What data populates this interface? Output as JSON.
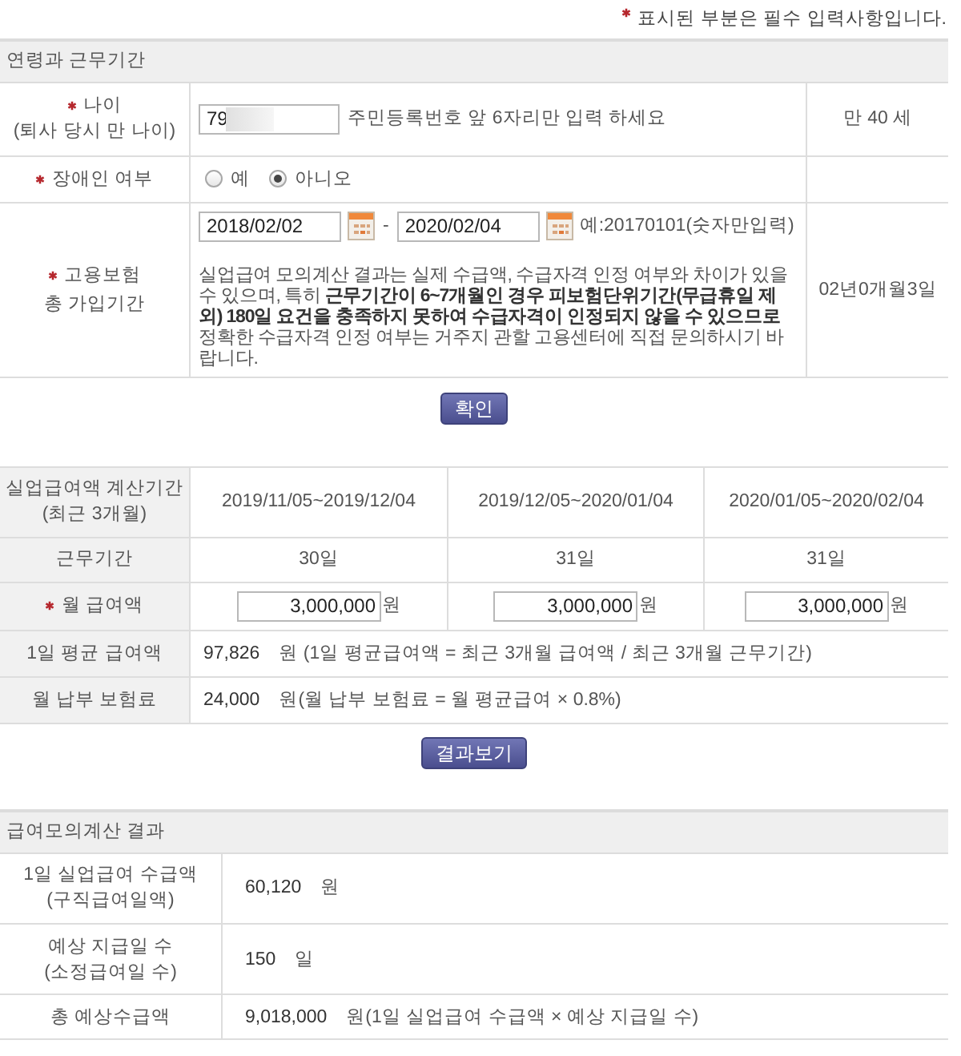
{
  "notice": {
    "text": "표시된 부분은 필수 입력사항입니다."
  },
  "age_section": {
    "title": "연령과 근무기간",
    "age": {
      "required": true,
      "label": "나이",
      "sublabel": "(퇴사 당시 만 나이)",
      "value": "79",
      "instruction": "주민등록번호 앞 6자리만 입력 하세요",
      "result": "만 40 세"
    },
    "disability": {
      "required": true,
      "label": "장애인 여부",
      "options": [
        {
          "label": "예",
          "selected": false
        },
        {
          "label": "아니오",
          "selected": true
        }
      ]
    },
    "insurance": {
      "required": true,
      "label": "고용보험",
      "sublabel": "총 가입기간",
      "start_date": "2018/02/02",
      "separator": "-",
      "end_date": "2020/02/04",
      "example": "예:20170101(숫자만입력)",
      "notice": "실업급여 모의계산 결과는 실제 수급액, 수급자격 인정 여부와 차이가 있을 수 있으며, 특히 **근무기간이 6~7개월인 경우 피보험단위기간(무급휴일 제외) 180일 요건을 충족하지 못하여 수급자격이 인정되지 않을 수 있으므로** 정확한 수급자격 인정 여부는 거주지 관할 고용센터에 직접 문의하시기 바랍니다.",
      "result": "02년0개월3일"
    }
  },
  "confirm_button": "확인",
  "calc_table": {
    "period_header": {
      "label": "실업급여액 계산기간",
      "sublabel": "(최근 3개월)",
      "periods": [
        "2019/11/05~2019/12/04",
        "2019/12/05~2020/01/04",
        "2020/01/05~2020/02/04"
      ]
    },
    "work_days": {
      "label": "근무기간",
      "values": [
        "30일",
        "31일",
        "31일"
      ]
    },
    "monthly_salary": {
      "required": true,
      "label": "월 급여액",
      "inputs": [
        {
          "value": "3,000,000",
          "unit": "원"
        },
        {
          "value": "3,000,000",
          "unit": "원"
        },
        {
          "value": "3,000,000",
          "unit": "원"
        }
      ]
    },
    "daily_average": {
      "label": "1일 평균 급여액",
      "value": "97,826",
      "note": "원 (1일 평균급여액 = 최근 3개월 급여액 / 최근 3개월 근무기간)"
    },
    "monthly_premium": {
      "label": "월 납부 보험료",
      "value": "24,000",
      "note": "원(월 납부 보험료 = 월 평균급여 × 0.8%)"
    }
  },
  "result_button": "결과보기",
  "result_section": {
    "title": "급여모의계산 결과",
    "rows": [
      {
        "label": "1일 실업급여 수급액",
        "sublabel": "(구직급여일액)",
        "value": "60,120",
        "note": "원"
      },
      {
        "label": "예상 지급일 수",
        "sublabel": "(소정급여일 수)",
        "value": "150",
        "note": "일"
      },
      {
        "label": "총 예상수급액",
        "value": "9,018,000",
        "note": "원(1일 실업급여 수급액 × 예상 지급일 수)"
      }
    ]
  }
}
